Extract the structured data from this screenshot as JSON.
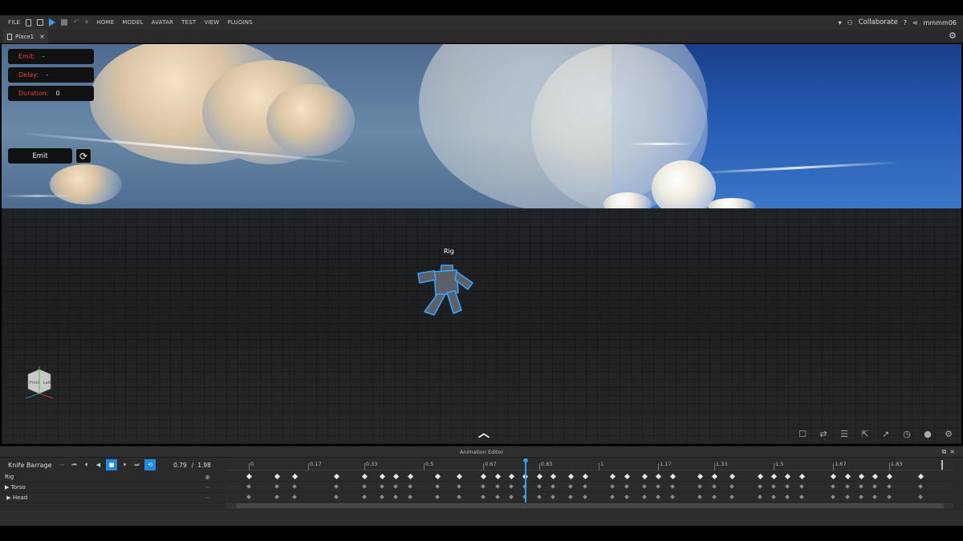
{
  "menubar": {
    "file": "FILE",
    "items": [
      "HOME",
      "MODEL",
      "AVATAR",
      "TEST",
      "VIEW",
      "PLUGINS"
    ],
    "collaborate": "Collaborate",
    "username": "mmmm06"
  },
  "tabs": [
    {
      "label": "Place1"
    }
  ],
  "effect_panel": {
    "emit_label": "Emit:",
    "emit_value": "-",
    "delay_label": "Delay:",
    "delay_value": "-",
    "duration_label": "Duration:",
    "duration_value": "0",
    "emit_button": "Emit"
  },
  "viewport": {
    "rig_label": "Rig",
    "nav_cube_faces": [
      "Front",
      "Left"
    ]
  },
  "animation_editor": {
    "title": "Animation Editor",
    "animation_name": "Knife Barrage",
    "current_time": "0.79",
    "separator": "/",
    "length": "1.98",
    "ruler_labels": [
      "0",
      "0.17",
      "0.33",
      "0.5",
      "0.67",
      "0.83",
      "1",
      "1.17",
      "1.33",
      "1.5",
      "1.67",
      "1.83"
    ],
    "tracks": [
      {
        "label": "Rig"
      },
      {
        "label": "Torso"
      },
      {
        "label": "Head"
      }
    ],
    "keyframe_times": [
      0,
      0.08,
      0.13,
      0.25,
      0.33,
      0.38,
      0.42,
      0.46,
      0.54,
      0.6,
      0.67,
      0.71,
      0.75,
      0.79,
      0.83,
      0.87,
      0.92,
      0.96,
      1.04,
      1.08,
      1.13,
      1.17,
      1.21,
      1.29,
      1.33,
      1.38,
      1.46,
      1.5,
      1.54,
      1.58,
      1.67,
      1.71,
      1.75,
      1.79,
      1.83,
      1.92
    ]
  }
}
